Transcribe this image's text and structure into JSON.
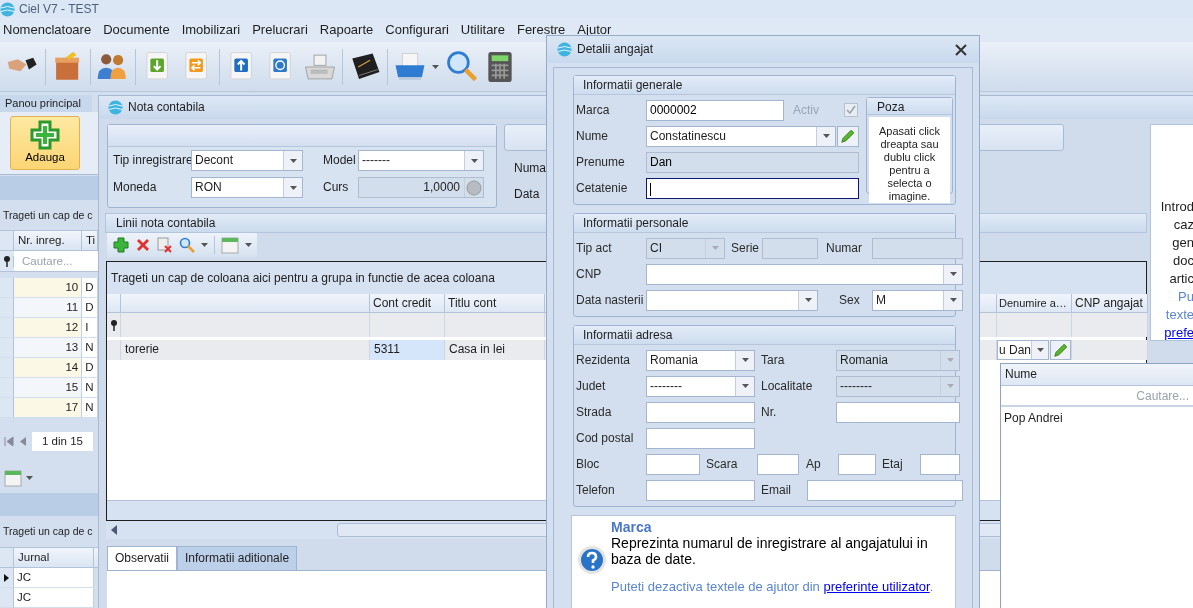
{
  "app_title": "Ciel V7 - TEST",
  "menu": [
    "Nomenclatoare",
    "Documente",
    "Imobilizari",
    "Prelucrari",
    "Rapoarte",
    "Configurari",
    "Utilitare",
    "Ferestre",
    "Ajutor"
  ],
  "main_panel": {
    "tab": "Panou principal",
    "add_button": "Adauga"
  },
  "registry_grid": {
    "group_hint": "Trageti un cap de c",
    "columns": [
      "Nr. inreg.",
      "Ti"
    ],
    "search_placeholder": "Cautare...",
    "pager": "1 din 15",
    "rows": [
      {
        "number": "10",
        "type": "D"
      },
      {
        "number": "11",
        "type": "D"
      },
      {
        "number": "12",
        "type": "I"
      },
      {
        "number": "13",
        "type": "N"
      },
      {
        "number": "14",
        "type": "D"
      },
      {
        "number": "15",
        "type": "N"
      },
      {
        "number": "17",
        "type": "N"
      }
    ]
  },
  "journal_grid": {
    "group_hint": "Trageti un cap de c",
    "columns": [
      "Jurnal"
    ],
    "rows": [
      {
        "journal": "JC",
        "selected": true
      },
      {
        "journal": "JC",
        "selected": false
      }
    ]
  },
  "note_window": {
    "title": "Nota contabila",
    "header_fields": [
      {
        "label": "Tip inregistrare",
        "kind": "combo",
        "value": "Decont"
      },
      {
        "label": "Model",
        "kind": "combo",
        "value": "-------"
      },
      {
        "label": "Moneda",
        "kind": "combo",
        "value": "RON"
      },
      {
        "label": "Curs",
        "kind": "rate",
        "value": "1,0000"
      }
    ],
    "side_labels": [
      "Numa",
      "Data"
    ],
    "lines": {
      "title": "Linii nota contabila",
      "group_hint": "Trageti un cap de coloana aici pentru a grupa in functie de acea coloana",
      "columns": [
        "Cont credit",
        "Titlu cont",
        "Denumire a…",
        "CNP angajat"
      ],
      "row": {
        "column_1": "torerie",
        "cont_credit": "5311",
        "titlu_cont": "Casa in lei",
        "denumire": "u Dan"
      }
    },
    "tabs": [
      {
        "label": "Observatii",
        "selected": true
      },
      {
        "label": "Informatii aditionale",
        "selected": false
      }
    ],
    "side_help": {
      "lines": [
        "Introd",
        "caz",
        "gen",
        "doc",
        "artic"
      ],
      "note_lines": [
        "Pu",
        "texte"
      ],
      "link": "prefe"
    }
  },
  "dialog": {
    "title": "Detalii angajat",
    "groups": [
      {
        "title": "Informatii generale",
        "photo": {
          "title": "Poza",
          "hint": "Apasati click dreapta sau dublu click pentru a selecta o imagine."
        },
        "fields": [
          {
            "label": "Marca",
            "kind": "text",
            "value": "0000002",
            "disabled": false,
            "focused": false
          },
          {
            "label": "Activ",
            "kind": "checkbox",
            "checked": true,
            "disabled": true
          },
          {
            "label": "Nume",
            "kind": "combo_edit",
            "value": "Constatinescu",
            "disabled": false,
            "focused": false
          },
          {
            "label": "Prenume",
            "kind": "text",
            "value": "Dan",
            "disabled": true,
            "focused": false
          },
          {
            "label": "Cetatenie",
            "kind": "text",
            "disabled": false,
            "focused": true
          }
        ]
      },
      {
        "title": "Informatii personale",
        "fields": [
          {
            "label": "Tip act",
            "kind": "combo",
            "value": "CI",
            "disabled": true,
            "focused": false
          },
          {
            "label": "Serie",
            "kind": "text",
            "disabled": true,
            "focused": false
          },
          {
            "label": "Numar",
            "kind": "text",
            "disabled": true,
            "focused": false
          },
          {
            "label": "CNP",
            "kind": "combo",
            "disabled": false,
            "focused": false
          },
          {
            "label": "Data nasterii",
            "kind": "combo",
            "disabled": false,
            "focused": false
          },
          {
            "label": "Sex",
            "kind": "combo",
            "value": "M",
            "disabled": false,
            "focused": false
          }
        ]
      },
      {
        "title": "Informatii adresa",
        "fields": [
          {
            "label": "Rezidenta",
            "kind": "combo",
            "value": "Romania",
            "disabled": false,
            "focused": false
          },
          {
            "label": "Tara",
            "kind": "combo",
            "value": "Romania",
            "disabled": true,
            "focused": false
          },
          {
            "label": "Judet",
            "kind": "combo",
            "value": "--------",
            "disabled": false,
            "focused": false
          },
          {
            "label": "Localitate",
            "kind": "combo",
            "value": "--------",
            "disabled": true,
            "focused": false
          },
          {
            "label": "Strada",
            "kind": "text",
            "disabled": false,
            "focused": false
          },
          {
            "label": "Nr.",
            "kind": "text",
            "disabled": false,
            "focused": false
          },
          {
            "label": "Cod postal",
            "kind": "text",
            "disabled": false,
            "focused": false
          },
          {
            "label": "Bloc",
            "kind": "text",
            "disabled": false,
            "focused": false
          },
          {
            "label": "Scara",
            "kind": "text",
            "disabled": false,
            "focused": false
          },
          {
            "label": "Ap",
            "kind": "text",
            "disabled": false,
            "focused": false
          },
          {
            "label": "Etaj",
            "kind": "text",
            "disabled": false,
            "focused": false
          },
          {
            "label": "Telefon",
            "kind": "text",
            "disabled": false,
            "focused": false
          },
          {
            "label": "Email",
            "kind": "text",
            "disabled": false,
            "focused": false
          }
        ]
      }
    ],
    "help": {
      "title": "Marca",
      "text": "Reprezinta numarul de inregistrare al angajatului in baza de date.",
      "note": "Puteti dezactiva textele de ajutor din ",
      "link": "preferinte utilizator",
      "note_end": "."
    }
  },
  "lookup": {
    "column": "Nume",
    "search_placeholder": "Cautare...",
    "rows": [
      "Pop Andrei"
    ]
  }
}
